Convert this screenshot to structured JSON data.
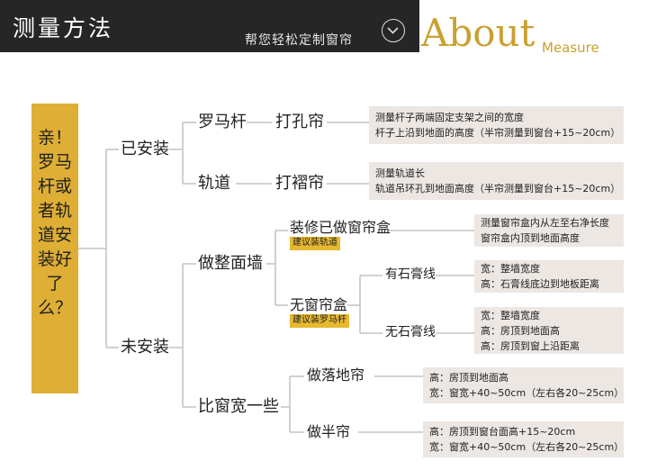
{
  "header": {
    "title": "测量方法",
    "subtitle": "帮您轻松定制窗帘",
    "about": "About",
    "measure": "Measure"
  },
  "question": "亲！罗马杆或者轨道安装好了么？",
  "installed": {
    "label": "已安装",
    "rod": {
      "label": "罗马杆",
      "style": "打孔帘",
      "info": [
        "测量杆子两端固定支架之间的宽度",
        "杆子上沿到地面的高度（半帘测量到窗台+15~20cm）"
      ]
    },
    "track": {
      "label": "轨道",
      "style": "打褶帘",
      "info": [
        "测量轨道长",
        "轨道吊环孔到地面高度（半帘测量到窗台+15~20cm）"
      ]
    }
  },
  "not_installed": {
    "label": "未安装",
    "full_wall": {
      "label": "做整面墙",
      "with_box": {
        "label": "装修已做窗帘盒",
        "tag": "建议装轨道",
        "info": [
          "测量窗帘盒内从左至右净长度",
          "窗帘盒内顶到地面高度"
        ]
      },
      "no_box": {
        "label": "无窗帘盒",
        "tag": "建议装罗马杆",
        "with_plaster": {
          "label": "有石膏线",
          "info": [
            "宽：整墙宽度",
            "高：石膏线底边到地板距离"
          ]
        },
        "no_plaster": {
          "label": "无石膏线",
          "info": [
            "宽：整墙宽度",
            "高：房顶到地面高",
            "高：房顶到窗上沿距离"
          ]
        }
      }
    },
    "wider": {
      "label": "比窗宽一些",
      "floor": {
        "label": "做落地帘",
        "info": [
          "高：房顶到地面高",
          "宽：窗宽+40~50cm（左右各20~25cm）"
        ]
      },
      "half": {
        "label": "做半帘",
        "info": [
          "高：房顶到窗台面高+15~20cm",
          "宽：窗宽+40~50cm（左右各20~25cm）"
        ]
      }
    }
  },
  "colors": {
    "gold": "#deae35",
    "tag": "#e7b830",
    "header_bg": "#262626",
    "info_bg": "#ece7e3"
  }
}
